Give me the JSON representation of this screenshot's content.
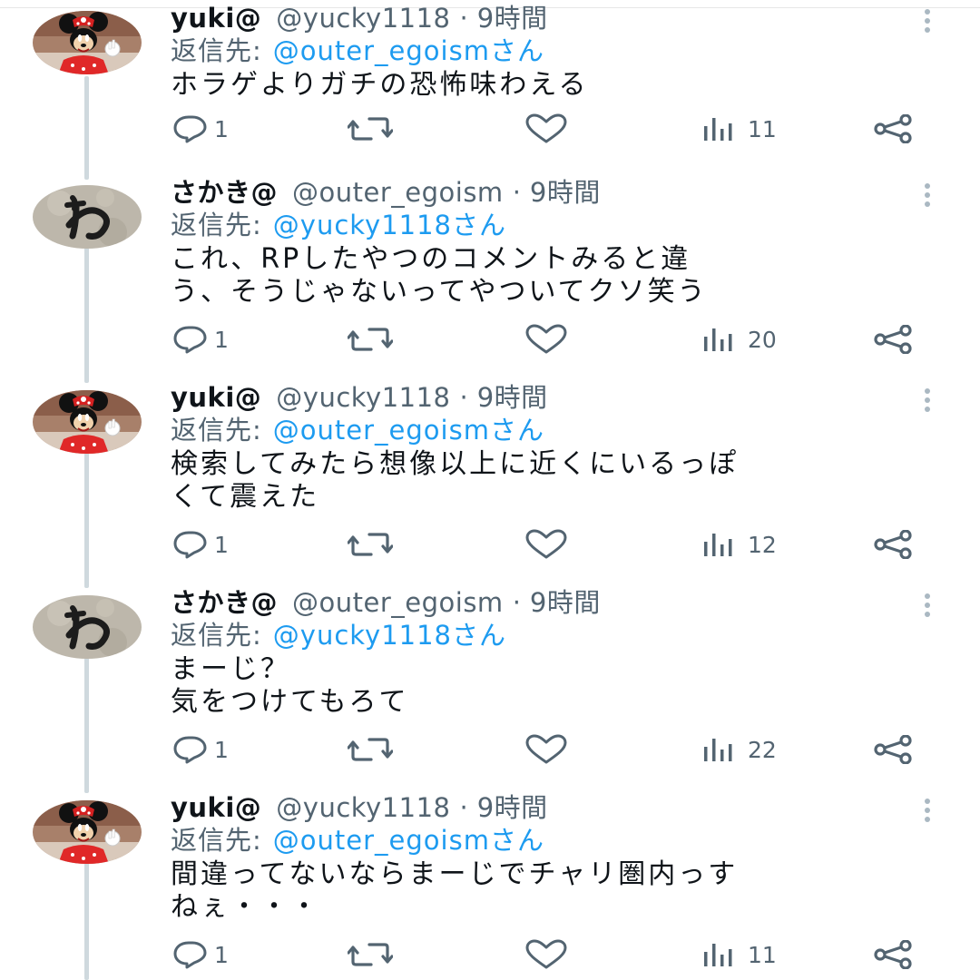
{
  "colors": {
    "text": "#0f1419",
    "secondary": "#536471",
    "link": "#1d9bf0",
    "thread_line": "#cfd9de"
  },
  "reply_prefix": "返信先:",
  "tweets": [
    {
      "avatar": "minnie-avatar",
      "name": "yuki@",
      "handle": "@yucky1118",
      "dot": "·",
      "time": "9時間",
      "reply_to": "@outer_egoismさん",
      "text": "ホラゲよりガチの恐怖味わえる",
      "replies": "1",
      "views": "11"
    },
    {
      "avatar": "wa-avatar",
      "name": "さかき@",
      "handle": "@outer_egoism",
      "dot": "·",
      "time": "9時間",
      "reply_to": "@yucky1118さん",
      "text": "これ、RPしたやつのコメントみると違\nう、そうじゃないってやついてクソ笑う",
      "replies": "1",
      "views": "20"
    },
    {
      "avatar": "minnie-avatar",
      "name": "yuki@",
      "handle": "@yucky1118",
      "dot": "·",
      "time": "9時間",
      "reply_to": "@outer_egoismさん",
      "text": "検索してみたら想像以上に近くにいるっぽ\nくて震えた",
      "replies": "1",
      "views": "12"
    },
    {
      "avatar": "wa-avatar",
      "name": "さかき@",
      "handle": "@outer_egoism",
      "dot": "·",
      "time": "9時間",
      "reply_to": "@yucky1118さん",
      "text": "まーじ？\n気をつけてもろて",
      "replies": "1",
      "views": "22"
    },
    {
      "avatar": "minnie-avatar",
      "name": "yuki@",
      "handle": "@yucky1118",
      "dot": "·",
      "time": "9時間",
      "reply_to": "@outer_egoismさん",
      "text": "間違ってないならまーじでチャリ圏内っす\nねぇ・・・",
      "replies": "1",
      "views": "11"
    }
  ]
}
